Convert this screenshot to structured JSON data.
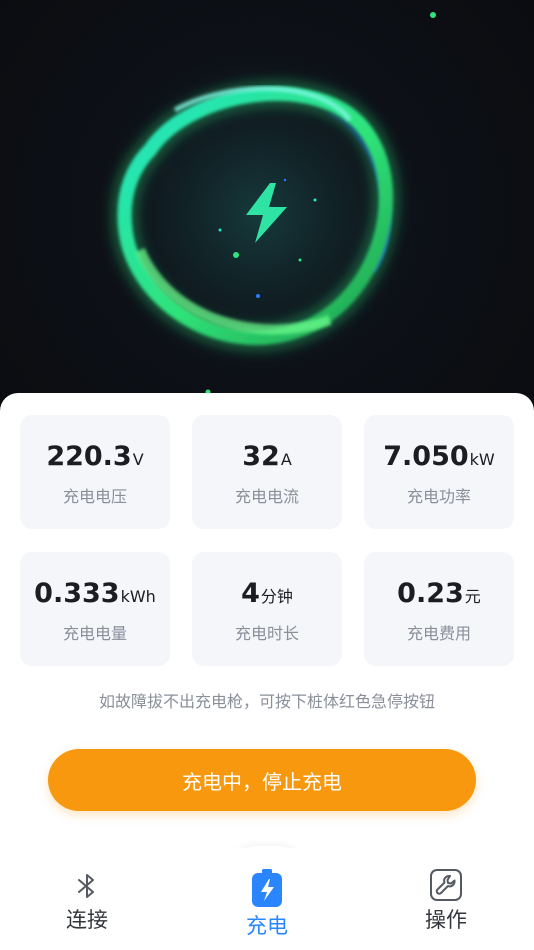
{
  "metrics": [
    {
      "value": "220.3",
      "unit": "V",
      "label": "充电电压"
    },
    {
      "value": "32",
      "unit": "A",
      "label": "充电电流"
    },
    {
      "value": "7.050",
      "unit": "kW",
      "label": "充电功率"
    },
    {
      "value": "0.333",
      "unit": "kWh",
      "label": "充电电量"
    },
    {
      "value": "4",
      "unit": "分钟",
      "label": "充电时长"
    },
    {
      "value": "0.23",
      "unit": "元",
      "label": "充电费用"
    }
  ],
  "hint": "如故障拔不出充电枪，可按下桩体红色急停按钮",
  "stop_button": "充电中，停止充电",
  "tabs": [
    {
      "label": "连接",
      "icon": "bluetooth-icon",
      "active": false
    },
    {
      "label": "充电",
      "icon": "battery-charging-icon",
      "active": true
    },
    {
      "label": "操作",
      "icon": "wrench-icon",
      "active": false
    }
  ],
  "colors": {
    "accent_orange": "#f7980f",
    "active_blue": "#2a86ff",
    "ring_green": "#2fe37a",
    "ring_cyan": "#22e6c8",
    "hero_bg": "#0d1117"
  }
}
